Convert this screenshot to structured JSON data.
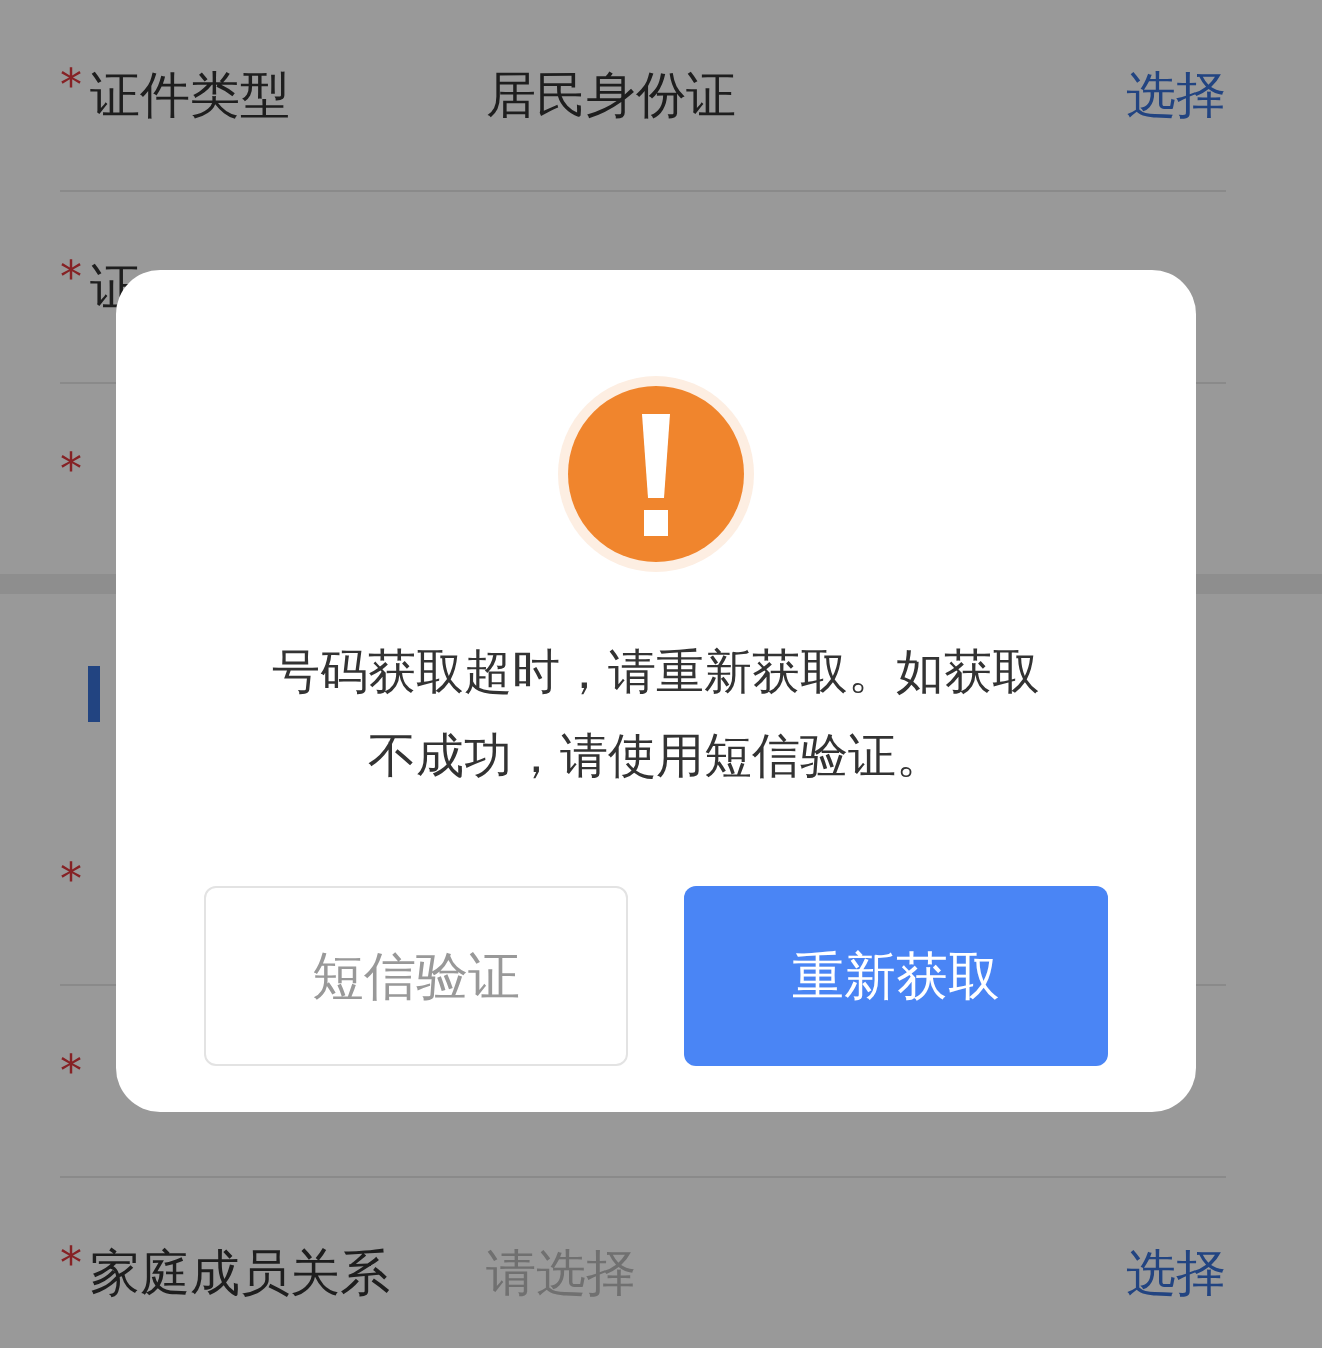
{
  "form": {
    "groups": [
      {
        "rows": [
          {
            "mark": "*",
            "label": "证件类型",
            "value": "居民身份证",
            "action": "选择"
          },
          {
            "mark": "*",
            "label": "证"
          },
          {
            "mark": "*"
          }
        ]
      },
      {
        "rows": [
          {
            "mark": "*"
          },
          {
            "mark": "*"
          },
          {
            "mark": "*",
            "label": "家庭成员关系",
            "placeholder": "请选择",
            "action": "选择"
          }
        ]
      }
    ]
  },
  "dialog": {
    "message": "号码获取超时，请重新获取。如获取不成功，请使用短信验证。",
    "buttons": [
      {
        "label": "短信验证",
        "kind": "secondary"
      },
      {
        "label": "重新获取",
        "kind": "primary"
      }
    ]
  }
}
